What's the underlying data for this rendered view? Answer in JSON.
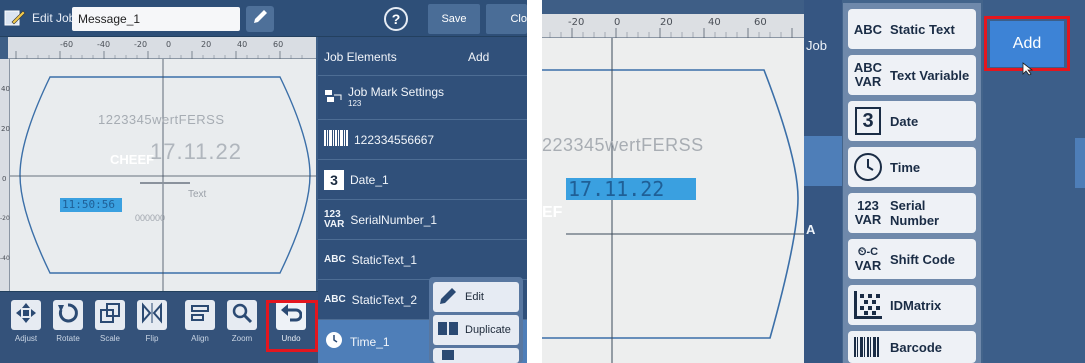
{
  "left_screen": {
    "header": {
      "title": "Edit Job",
      "job_name": "Message_1",
      "help_label": "?",
      "save_label": "Save",
      "close_label": "Clo"
    },
    "ruler_top_ticks": [
      "-60",
      "-40",
      "-20",
      "0",
      "20",
      "40",
      "60"
    ],
    "ruler_left_ticks": [
      "40",
      "20",
      "0",
      "-20",
      "-40"
    ],
    "canvas": {
      "text_line": "1223345wertFERSS",
      "date_text": "17.11.22",
      "watermark": "CHEEF",
      "time_text": "11:50:56",
      "static_text": "Text",
      "serial_text": "000000"
    },
    "toolbar": {
      "adjust": "Adjust",
      "rotate": "Rotate",
      "scale": "Scale",
      "flip": "Flip",
      "align": "Align",
      "zoom": "Zoom",
      "undo": "Undo"
    },
    "sidebar": {
      "title": "Job Elements",
      "add_label": "Add",
      "items": [
        {
          "label": "Job Mark Settings",
          "sub": "123",
          "icon": "job-mark-icon"
        },
        {
          "label": "122334556667",
          "icon": "barcode-icon"
        },
        {
          "label": "Date_1",
          "icon": "date-icon",
          "glyph": "3"
        },
        {
          "label": "SerialNumber_1",
          "icon": "serial-number-icon",
          "glyph_top": "123",
          "glyph_bottom": "VAR"
        },
        {
          "label": "StaticText_1",
          "icon": "static-text-icon",
          "glyph": "ABC"
        },
        {
          "label": "StaticText_2",
          "icon": "static-text-icon",
          "glyph": "ABC"
        },
        {
          "label": "Time_1",
          "icon": "clock-icon"
        }
      ]
    },
    "popup": {
      "edit_label": "Edit",
      "duplicate_label": "Duplicate"
    }
  },
  "right_screen": {
    "ruler_top_ticks": [
      "-20",
      "0",
      "20",
      "40",
      "60"
    ],
    "canvas": {
      "text_line": "223345wertFERSS",
      "date_text": "17.11.22",
      "partial_letters": "EF"
    },
    "partial_label_job": "Job",
    "partial_label_a": "A",
    "add_label": "Add",
    "menu": [
      {
        "label": "Static Text",
        "icon": "abc-icon",
        "glyph": "ABC"
      },
      {
        "label": "Text Variable",
        "icon": "abc-var-icon",
        "glyph_top": "ABC",
        "glyph_bottom": "VAR"
      },
      {
        "label": "Date",
        "icon": "date-icon",
        "glyph": "3"
      },
      {
        "label": "Time",
        "icon": "clock-icon"
      },
      {
        "label": "Serial Number",
        "icon": "serial-var-icon",
        "glyph_top": "123",
        "glyph_bottom": "VAR"
      },
      {
        "label": "Shift Code",
        "icon": "shift-code-icon",
        "glyph_top": "⏲-C",
        "glyph_bottom": "VAR"
      },
      {
        "label": "IDMatrix",
        "icon": "datamatrix-icon"
      },
      {
        "label": "Barcode",
        "icon": "barcode-icon"
      }
    ]
  },
  "colors": {
    "highlight": "#e4161e",
    "selected_blue": "#4e7eb8",
    "canvas_text_blue": "#3aa0e0"
  }
}
